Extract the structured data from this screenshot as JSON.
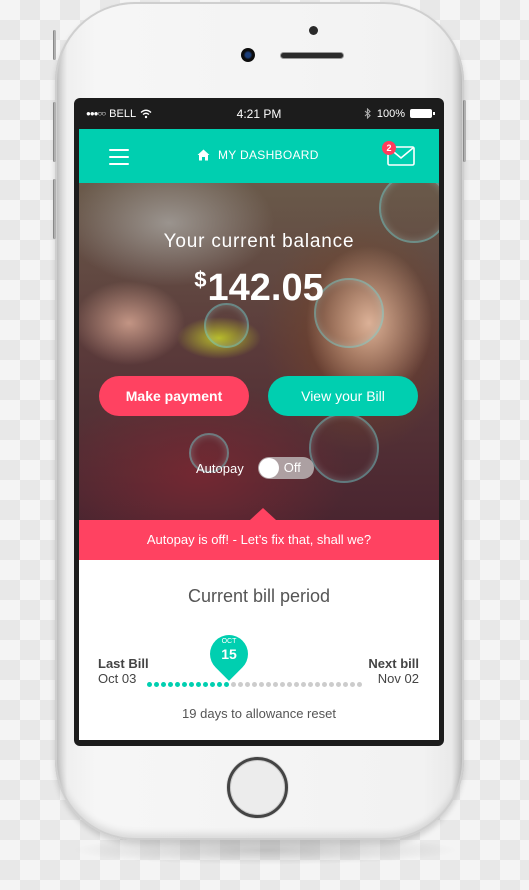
{
  "status_bar": {
    "signal": "●●●○○",
    "carrier": "BELL",
    "time": "4:21 PM",
    "battery": "100%"
  },
  "nav": {
    "title": "MY DASHBOARD",
    "mail_badge": "2"
  },
  "hero": {
    "balance_label": "Your current balance",
    "currency": "$",
    "balance": "142.05",
    "make_payment_label": "Make payment",
    "view_bill_label": "View your Bill",
    "autopay_label": "Autopay",
    "autopay_state": "Off"
  },
  "alert": {
    "text": "Autopay is off!  -  Let’s fix that, shall we?"
  },
  "bill_period": {
    "title": "Current bill period",
    "last_bill_label": "Last Bill",
    "last_bill_date": "Oct 03",
    "next_bill_label": "Next bill",
    "next_bill_date": "Nov 02",
    "marker_month": "OCT",
    "marker_day": "15",
    "elapsed_days": 12,
    "remaining_days": 19,
    "reset_text": "19 days to allowance reset"
  },
  "colors": {
    "teal": "#00cfb0",
    "pink": "#ff4261",
    "dot_inactive": "#cccccc"
  }
}
